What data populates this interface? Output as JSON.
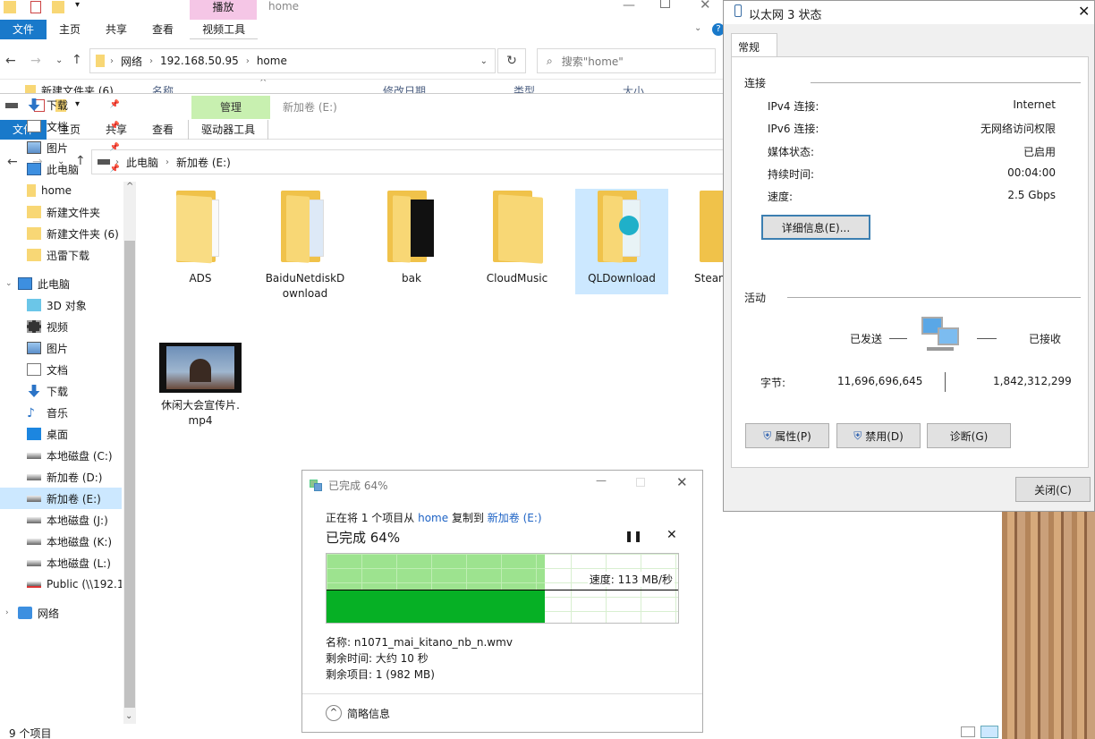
{
  "back_explorer": {
    "qat": [
      "▾"
    ],
    "context_tab_header": "播放",
    "title": "home",
    "tabs": [
      "文件",
      "主页",
      "共享",
      "查看",
      "视频工具"
    ],
    "address": [
      "网络",
      "192.168.50.95",
      "home"
    ],
    "search_placeholder": "搜索\"home\"",
    "partial_row": "新建文件夹 (6)",
    "column_headers": [
      "名称",
      "修改日期",
      "类型",
      "大小"
    ]
  },
  "front_explorer": {
    "context_tab_header": "管理",
    "title": "新加卷 (E:)",
    "tabs": [
      "文件",
      "主页",
      "共享",
      "查看",
      "驱动器工具"
    ],
    "address": [
      "此电脑",
      "新加卷 (E:)"
    ],
    "nav": [
      {
        "label": "下载",
        "icon": "download-icon",
        "pinned": true
      },
      {
        "label": "文档",
        "icon": "document-icon",
        "pinned": true
      },
      {
        "label": "图片",
        "icon": "picture-icon",
        "pinned": true
      },
      {
        "label": "此电脑",
        "icon": "computer-icon",
        "pinned": true
      },
      {
        "label": "home",
        "icon": "network-folder-icon",
        "pinned": false
      },
      {
        "label": "新建文件夹",
        "icon": "folder-icon",
        "pinned": false
      },
      {
        "label": "新建文件夹 (6)",
        "icon": "folder-icon",
        "pinned": false
      },
      {
        "label": "迅雷下载",
        "icon": "folder-icon",
        "pinned": false
      },
      {
        "label": "此电脑",
        "icon": "computer-icon",
        "pinned": false
      },
      {
        "label": "3D 对象",
        "icon": "cube-icon",
        "pinned": false
      },
      {
        "label": "视频",
        "icon": "video-icon",
        "pinned": false
      },
      {
        "label": "图片",
        "icon": "picture-icon",
        "pinned": false
      },
      {
        "label": "文档",
        "icon": "document-icon",
        "pinned": false
      },
      {
        "label": "下载",
        "icon": "download-icon",
        "pinned": false
      },
      {
        "label": "音乐",
        "icon": "music-icon",
        "pinned": false
      },
      {
        "label": "桌面",
        "icon": "desktop-icon",
        "pinned": false
      },
      {
        "label": "本地磁盘 (C:)",
        "icon": "drive-icon",
        "pinned": false
      },
      {
        "label": "新加卷 (D:)",
        "icon": "drive-icon",
        "pinned": false
      },
      {
        "label": "新加卷 (E:)",
        "icon": "drive-icon",
        "pinned": false,
        "selected": true
      },
      {
        "label": "本地磁盘 (J:)",
        "icon": "drive-icon",
        "pinned": false
      },
      {
        "label": "本地磁盘 (K:)",
        "icon": "drive-icon",
        "pinned": false
      },
      {
        "label": "本地磁盘 (L:)",
        "icon": "drive-icon",
        "pinned": false
      },
      {
        "label": "Public (\\\\192.168",
        "icon": "network-drive-icon",
        "pinned": false
      },
      {
        "label": "网络",
        "icon": "network-icon",
        "pinned": false
      }
    ],
    "files": [
      {
        "name": "ADS"
      },
      {
        "name": "BaiduNetdiskDownload"
      },
      {
        "name": "bak"
      },
      {
        "name": "CloudMusic"
      },
      {
        "name": "QLDownload",
        "selected": true
      },
      {
        "name": "Steam"
      },
      {
        "name": "休闲大会宣传片.mp4"
      }
    ],
    "status": "9 个项目"
  },
  "network_status": {
    "title": "以太网 3 状态",
    "tab": "常规",
    "connection_group": "连接",
    "rows": [
      {
        "label": "IPv4 连接:",
        "value": "Internet"
      },
      {
        "label": "IPv6 连接:",
        "value": "无网络访问权限"
      },
      {
        "label": "媒体状态:",
        "value": "已启用"
      },
      {
        "label": "持续时间:",
        "value": "00:04:00"
      },
      {
        "label": "速度:",
        "value": "2.5 Gbps"
      }
    ],
    "details_button": "详细信息(E)...",
    "activity_group": "活动",
    "sent_label": "已发送",
    "received_label": "已接收",
    "bytes_label": "字节:",
    "bytes_sent": "11,696,696,645",
    "bytes_received": "1,842,312,299",
    "properties_button": "属性(P)",
    "disable_button": "禁用(D)",
    "diagnose_button": "诊断(G)",
    "close_button": "关闭(C)"
  },
  "copy_dialog": {
    "title": "已完成 64%",
    "line_prefix": "正在将 1 个项目从",
    "source": "home",
    "line_mid": "复制到",
    "destination": "新加卷 (E:)",
    "progress_heading": "已完成 64%",
    "progress": 0.64,
    "speed": "速度: 113 MB/秒",
    "name_line": "名称: n1071_mai_kitano_nb_n.wmv",
    "time_line": "剩余时间: 大约 10 秒",
    "items_line": "剩余项目: 1 (982 MB)",
    "less_details": "简略信息"
  },
  "colors": {
    "accent": "#1979ca",
    "progress": "#06b025",
    "progress_light": "#9de38f"
  }
}
